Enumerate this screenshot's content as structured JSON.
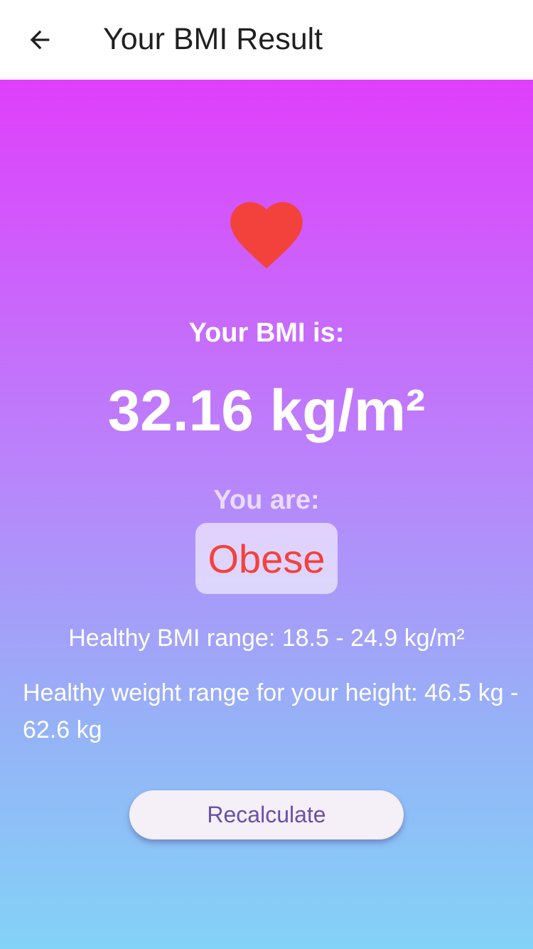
{
  "app_bar": {
    "title": "Your BMI Result",
    "back_icon": "arrow-back-icon"
  },
  "result": {
    "heart_icon": "heart-icon",
    "heart_color": "#f3423c",
    "bmi_label": "Your BMI is:",
    "bmi_value": "32.16 kg/m²",
    "you_are_label": "You are:",
    "category": "Obese",
    "category_color": "#f3423c",
    "healthy_bmi_range": "Healthy BMI range: 18.5 - 24.9 kg/m²",
    "healthy_weight_range": "Healthy weight range for your height: 46.5 kg - 62.6 kg"
  },
  "actions": {
    "recalculate_label": "Recalculate"
  },
  "colors": {
    "gradient_top": "#df3ffb",
    "gradient_bottom": "#83d2f7",
    "button_text": "#6a4fa6"
  }
}
